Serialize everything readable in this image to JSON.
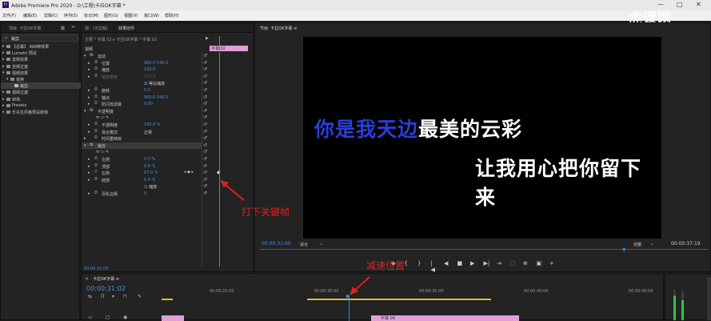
{
  "window": {
    "title": "Adobe Premiere Pro 2020 - D:\\工程\\卡拉OK字幕 *",
    "controls": [
      "—",
      "□",
      "✕"
    ]
  },
  "menu": [
    "文件(F)",
    "编辑(E)",
    "剪辑(C)",
    "序列(S)",
    "标记(M)",
    "图形(G)",
    "视图(V)",
    "窗口(W)",
    "帮助(H)"
  ],
  "watermark": "虎课网",
  "project": {
    "tabs": [
      "项目: 卡拉OK字幕",
      "效"
    ],
    "search": "裁剪",
    "tree": [
      {
        "label": "【总幕】 808种效果",
        "indent": 1
      },
      {
        "label": "Lumetri 预设",
        "indent": 1
      },
      {
        "label": "音频效果",
        "indent": 1
      },
      {
        "label": "音频过渡",
        "indent": 1
      },
      {
        "label": "视频效果",
        "indent": 1
      },
      {
        "label": "变换",
        "indent": 2
      },
      {
        "label": "裁剪",
        "indent": 3,
        "selected": true
      },
      {
        "label": "视频过渡",
        "indent": 1
      },
      {
        "label": "转场",
        "indent": 1
      },
      {
        "label": "Presets",
        "indent": 1
      },
      {
        "label": "乐先生风格预设转场",
        "indent": 1
      }
    ]
  },
  "effects": {
    "tabs": [
      "源：(无剪辑)",
      "效果控件"
    ],
    "header": "主要 * 字幕 02  ▸  卡拉OK字幕 * 字幕 02",
    "clip_label": "字幕 02",
    "section": "视频",
    "rows": [
      {
        "label": "运动",
        "value": "",
        "indent": 1,
        "fx": true
      },
      {
        "label": "位置",
        "value": "960.0     540.0",
        "indent": 2
      },
      {
        "label": "缩放",
        "value": "100.0",
        "indent": 2
      },
      {
        "label": "缩放宽度",
        "value": "100.0",
        "indent": 2,
        "dim": true
      },
      {
        "label": "",
        "value": "☑ 等比缩放",
        "indent": 3
      },
      {
        "label": "旋转",
        "value": "0.0",
        "indent": 2
      },
      {
        "label": "锚点",
        "value": "960.0     540.0",
        "indent": 2
      },
      {
        "label": "防闪烁滤镜",
        "value": "0.00",
        "indent": 2
      },
      {
        "label": "不透明度",
        "value": "",
        "indent": 1,
        "fx": true
      },
      {
        "label": "",
        "value": "⬭ ▭ ✎",
        "indent": 2
      },
      {
        "label": "不透明度",
        "value": "100.0 %",
        "indent": 2
      },
      {
        "label": "混合模式",
        "value": "正常",
        "indent": 2
      },
      {
        "label": "时间重映射",
        "value": "",
        "indent": 1
      },
      {
        "label": "裁剪",
        "value": "",
        "indent": 1,
        "fx": true,
        "highlight": true
      },
      {
        "label": "",
        "value": "⬭ ▭ ✎",
        "indent": 2
      },
      {
        "label": "左侧",
        "value": "0.0 %",
        "indent": 2
      },
      {
        "label": "顶部",
        "value": "0.0 %",
        "indent": 2
      },
      {
        "label": "右侧",
        "value": "67.0 %",
        "indent": 2
      },
      {
        "label": "底部",
        "value": "0.0 %",
        "indent": 2
      },
      {
        "label": "",
        "value": "☐ 缩放",
        "indent": 3
      },
      {
        "label": "羽化边缘",
        "value": "0",
        "indent": 2
      }
    ],
    "timecode": "00:00:31:00"
  },
  "program": {
    "title": "节目: 卡拉OK字幕  ≡",
    "lyric1_sung": "你是我天边",
    "lyric1_rest": "最美的云彩",
    "lyric2": "让我用心把你留下来",
    "timecode": "00:00:31:00",
    "fit": "适合",
    "quality": "完整",
    "duration": "00:00:37:19",
    "transport": [
      "◆",
      "{",
      "}",
      "|◀",
      "◀",
      "■",
      "▶",
      "▶|",
      "⇥",
      "⬚",
      "⊕",
      "▣",
      "+"
    ]
  },
  "timeline": {
    "tab": "卡拉OK字幕  ≡",
    "timecode": "00:00:31:02",
    "ruler": [
      "00:00:25:00",
      "00:00:30:00",
      "00:00:35:00",
      "00:00:40:00",
      "00:00:45:00"
    ],
    "clip": "字幕 04"
  },
  "annotations": {
    "keyframe": "打下关键帧",
    "slowdown": "减速位置"
  },
  "colors": {
    "accent": "#2d8ceb",
    "pink": "#e0a0d8",
    "red": "#e02020",
    "lyric_blue": "#2a3ed8"
  }
}
